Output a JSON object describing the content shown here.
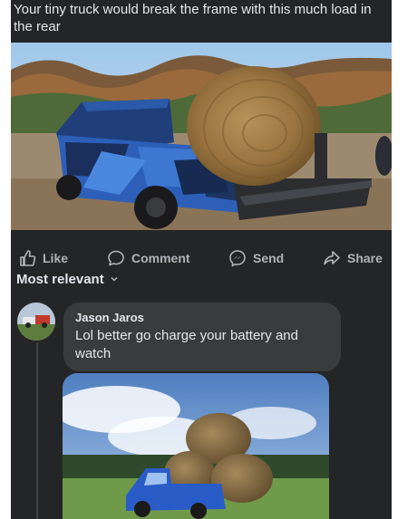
{
  "post": {
    "caption": "Your tiny truck would break the frame with this much load in the rear"
  },
  "actions": {
    "like_label": "Like",
    "comment_label": "Comment",
    "send_label": "Send",
    "share_label": "Share"
  },
  "comments_sort": {
    "label": "Most relevant"
  },
  "comment": {
    "author": "Jason Jaros",
    "text": "Lol better go charge your battery and watch"
  },
  "colors": {
    "panel_bg": "#242526",
    "bubble_bg": "#3a3b3c",
    "text_primary": "#e4e6eb",
    "text_secondary": "#b0b3b8"
  },
  "icons": {
    "like": "thumbs-up-icon",
    "comment": "speech-bubble-icon",
    "send": "messenger-icon",
    "share": "share-arrow-icon",
    "sort": "chevron-down-icon"
  }
}
